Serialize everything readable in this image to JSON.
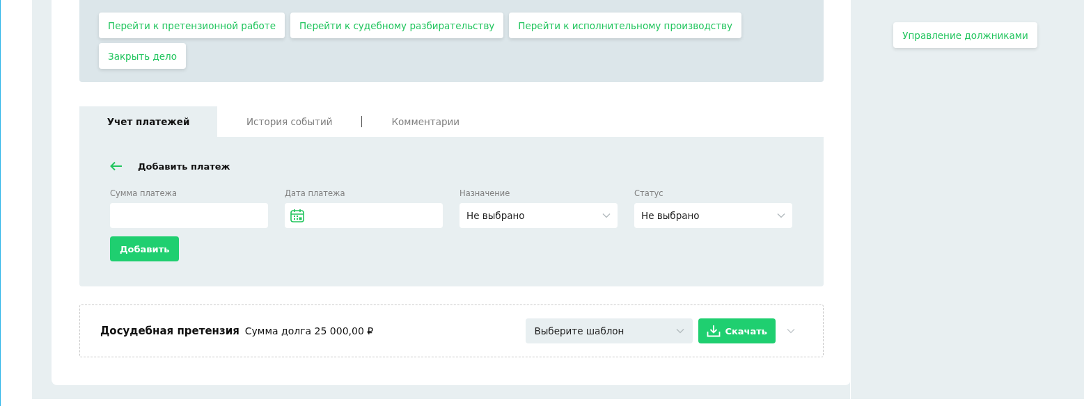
{
  "actions": [
    "Перейти к претензионной работе",
    "Перейти к судебному разбирательству",
    "Перейти к исполнительному производству",
    "Закрыть дело"
  ],
  "sidebar": {
    "button": "Управление должниками"
  },
  "tabs": [
    {
      "label": "Учет платежей",
      "selected": true
    },
    {
      "label": "История событий",
      "selected": false
    },
    {
      "label": "Комментарии",
      "selected": false
    }
  ],
  "payment_form": {
    "title": "Добавить платеж",
    "fields": [
      {
        "label": "Сумма платежа",
        "kind": "input"
      },
      {
        "label": "Дата платежа",
        "kind": "date"
      },
      {
        "label": "Назначение",
        "kind": "select",
        "value": "Не выбрано"
      },
      {
        "label": "Статус",
        "kind": "select",
        "value": "Не выбрано"
      }
    ],
    "submit": "Добавить"
  },
  "claim": {
    "title": "Досудебная претензия",
    "amount": "Сумма долга 25 000,00 ₽",
    "template": "Выберите шаблон",
    "download": "Скачать"
  }
}
